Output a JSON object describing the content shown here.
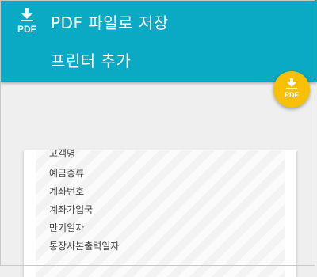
{
  "print_menu": {
    "items": [
      {
        "label": "PDF 파일로 저장",
        "icon": "pdf-download-icon"
      },
      {
        "label": "프린터 추가"
      }
    ]
  },
  "fab": {
    "icon_text": "PDF",
    "icon": "pdf-download-icon"
  },
  "preview": {
    "rows": [
      "고객명",
      "예금종류",
      "계좌번호",
      "계좌가입국",
      "만기일자",
      "통장사본출력일자"
    ]
  },
  "colors": {
    "header": "#0aa9c4",
    "fab": "#f7c000",
    "background": "#efefef"
  }
}
